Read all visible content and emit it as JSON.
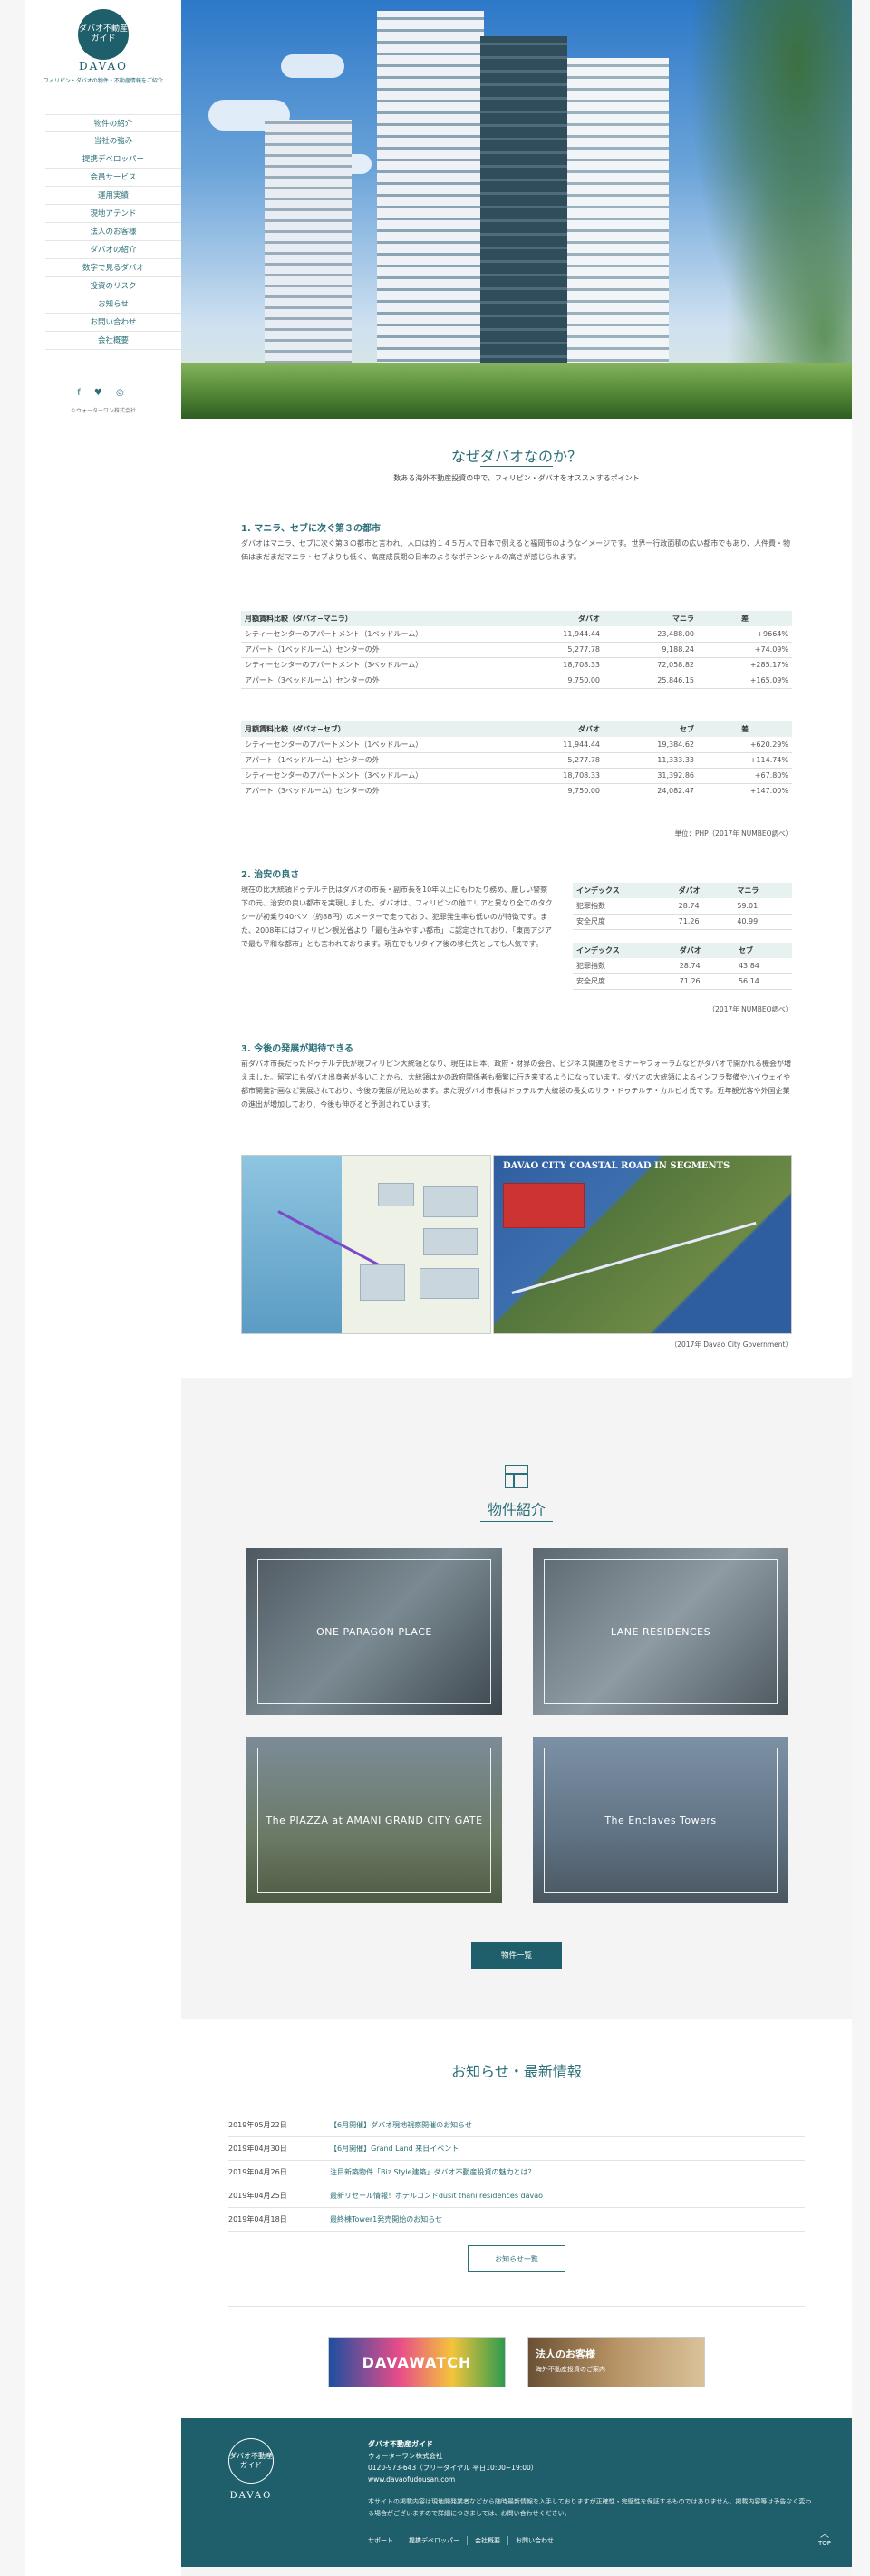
{
  "sidebar": {
    "logo_text": "ダバオ不動産ガイド",
    "logo_word": "DAVAO",
    "tagline": "フィリピン・ダバオの物件・不動産情報をご紹介",
    "nav": [
      "物件の紹介",
      "当社の強み",
      "提携デベロッパー",
      "会員サービス",
      "運用実績",
      "現地アテンド",
      "法人のお客様",
      "ダバオの紹介",
      "数字で見るダバオ",
      "投資のリスク",
      "お知らせ",
      "お問い合わせ",
      "会社概要"
    ],
    "social_icons": [
      "facebook-icon",
      "twitter-icon",
      "instagram-icon"
    ],
    "social_glyphs": "f ♥ ◎",
    "copyright": "©ウォーターワン株式会社"
  },
  "why": {
    "title": "なぜダバオなのか？",
    "subtitle": "数ある海外不動産投資の中で、フィリピン・ダバオをオススメするポイント",
    "s1_heading": "1. マニラ、セブに次ぐ第３の都市",
    "s1_body": "ダバオはマニラ、セブに次ぐ第３の都市と言われ、人口は約１４５万人で日本で例えると福岡市のようなイメージです。世界一行政面積の広い都市でもあり、人件費・物価はまだまだマニラ・セブよりも低く、高度成長期の日本のようなポテンシャルの高さが感じられます。",
    "table1": {
      "headers": [
        "月額賃料比較（ダバオ−マニラ）",
        "ダバオ",
        "マニラ",
        "差"
      ],
      "rows": [
        [
          "シティーセンターのアパートメント（1ベッドルーム）",
          "11,944.44",
          "23,488.00",
          "+9664%"
        ],
        [
          "アパート（1ベッドルーム）センターの外",
          "5,277.78",
          "9,188.24",
          "+74.09%"
        ],
        [
          "シティーセンターのアパートメント（3ベッドルーム）",
          "18,708.33",
          "72,058.82",
          "+285.17%"
        ],
        [
          "アパート（3ベッドルーム）センターの外",
          "9,750.00",
          "25,846.15",
          "+165.09%"
        ]
      ]
    },
    "table2": {
      "headers": [
        "月額賃料比較（ダバオ−セブ）",
        "ダバオ",
        "セブ",
        "差"
      ],
      "rows": [
        [
          "シティーセンターのアパートメント（1ベッドルーム）",
          "11,944.44",
          "19,384.62",
          "+620.29%"
        ],
        [
          "アパート（1ベッドルーム）センターの外",
          "5,277.78",
          "11,333.33",
          "+114.74%"
        ],
        [
          "シティーセンターのアパートメント（3ベッドルーム）",
          "18,708.33",
          "31,392.86",
          "+67.80%"
        ],
        [
          "アパート（3ベッドルーム）センターの外",
          "9,750.00",
          "24,082.47",
          "+147.00%"
        ]
      ]
    },
    "table_note": "単位：PHP（2017年 NUMBEO調べ）",
    "s2_heading": "2. 治安の良さ",
    "s2_body": "現在の比大統領ドゥテルテ氏はダバオの市長・副市長を10年以上にもわたり務め、厳しい警察下の元、治安の良い都市を実現しました。ダバオは、フィリピンの他エリアと異なり全てのタクシーが初乗り40ペソ（約88円）のメーターで走っており、犯罪発生率も低いのが特徴です。また、2008年にはフィリピン観光省より「最も住みやすい都市」に認定されており、「東南アジアで最も平和な都市」とも言われております。現在でもリタイア後の移住先としても人気です。",
    "crime1": {
      "headers": [
        "インデックス",
        "ダバオ",
        "マニラ"
      ],
      "rows": [
        [
          "犯罪指数",
          "28.74",
          "59.01"
        ],
        [
          "安全尺度",
          "71.26",
          "40.99"
        ]
      ]
    },
    "crime2": {
      "headers": [
        "インデックス",
        "ダバオ",
        "セブ"
      ],
      "rows": [
        [
          "犯罪指数",
          "28.74",
          "43.84"
        ],
        [
          "安全尺度",
          "71.26",
          "56.14"
        ]
      ]
    },
    "crime_note": "（2017年 NUMBEO調べ）",
    "s3_heading": "3. 今後の発展が期待できる",
    "s3_body": "前ダバオ市長だったドゥテルテ氏が現フィリピン大統領となり、現在は日本、政府・財界の会合、ビジネス関連のセミナーやフォーラムなどがダバオで開かれる機会が増えました。留学にもダバオ出身者が多いことから、大統領はかの政府関係者も頻繁に行き来するようになっています。ダバオの大統領によるインフラ整備やハイウェイや都市開発計画など発展されており、今後の発展が見込めます。また現ダバオ市長はドゥテルテ大統領の長女のサラ・ドゥテルテ・カルピオ氏です。近年観光客や外国企業の進出が増加しており、今後も伸びると予測されています。",
    "map_title": "DAVAO CITY COASTAL ROAD IN SEGMENTS",
    "map_source": "（2017年 Davao City Government）"
  },
  "properties": {
    "title": "物件紹介",
    "cards": [
      "ONE PARAGON PLACE",
      "LANE RESIDENCES",
      "The PIAZZA at AMANI GRAND CITY GATE",
      "The Enclaves Towers"
    ],
    "list_button": "物件一覧"
  },
  "news": {
    "title": "お知らせ・最新情報",
    "items": [
      {
        "date": "2019年05月22日",
        "title": "【6月開催】ダバオ現地視察開催のお知らせ"
      },
      {
        "date": "2019年04月30日",
        "title": "【6月開催】Grand Land 来日イベント"
      },
      {
        "date": "2019年04月26日",
        "title": "注目新築物件「Biz Style建築」ダバオ不動産投資の魅力とは？"
      },
      {
        "date": "2019年04月25日",
        "title": "最新リセール情報！ホテルコンドdusit thani residences davao"
      },
      {
        "date": "2019年04月18日",
        "title": "最終棟Tower1発売開始のお知らせ"
      }
    ],
    "list_button": "お知らせ一覧",
    "banner1": "DAVAWATCH",
    "banner2_a": "法人のお客様",
    "banner2_b": "海外不動産投資のご案内"
  },
  "footer": {
    "logo_text": "ダバオ不動産ガイド",
    "logo_word": "DAVAO",
    "site_name": "ダバオ不動産ガイド",
    "company": "ウォーターワン株式会社",
    "phone": "0120-973-643（フリーダイヤル 平日10:00~19:00）",
    "url": "www.davaofudousan.com",
    "disclaimer": "本サイトの掲載内容は現地開発業者などから随時最新情報を入手しておりますが正確性・完璧性を保証するものではありません。掲載内容等は予告なく変わる場合がございますので詳細につきましては、お問い合わせください。",
    "links": [
      "サポート",
      "提携デベロッパー",
      "会社概要",
      "お問い合わせ"
    ],
    "top": "TOP"
  }
}
